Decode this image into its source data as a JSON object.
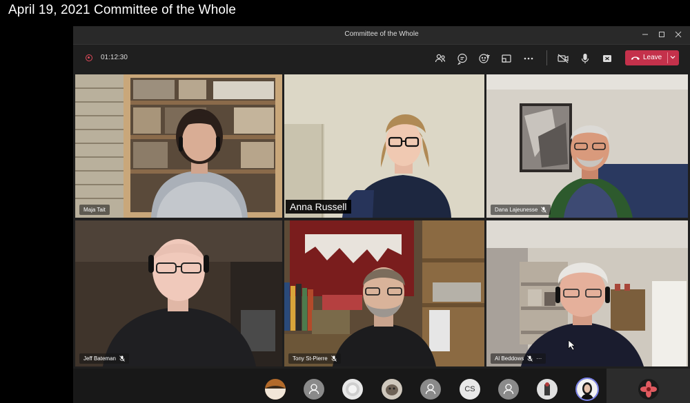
{
  "caption": "April 19, 2021 Committee of the Whole",
  "window": {
    "title": "Committee of the Whole",
    "controls": [
      "minimize-icon",
      "maximize-icon",
      "close-icon"
    ]
  },
  "toolbar": {
    "recording_time": "01:12:30",
    "icons": [
      "participants-icon",
      "chat-icon",
      "reactions-icon",
      "share-tray-icon",
      "more-options-icon",
      "camera-off-icon",
      "microphone-icon",
      "share-screen-icon"
    ],
    "leave_label": "Leave",
    "leave_color": "#c4314b"
  },
  "participants": [
    {
      "name": "Maja Tait",
      "muted": false
    },
    {
      "name": "Anna Russell",
      "muted": false,
      "spotlight_label": true
    },
    {
      "name": "Dana Lajeunesse",
      "muted": true
    },
    {
      "name": "Jeff Bateman",
      "muted": true
    },
    {
      "name": "Tony St-Pierre",
      "muted": true
    },
    {
      "name": "Al Beddows",
      "muted": true,
      "more": "···"
    }
  ],
  "dock": {
    "avatars": [
      "photo",
      "person",
      "photo-round",
      "photo-tiger",
      "person",
      "CS",
      "person",
      "photo-figure",
      "photo-woman-active"
    ],
    "initials": "CS",
    "right_avatar": "flower-photo"
  }
}
